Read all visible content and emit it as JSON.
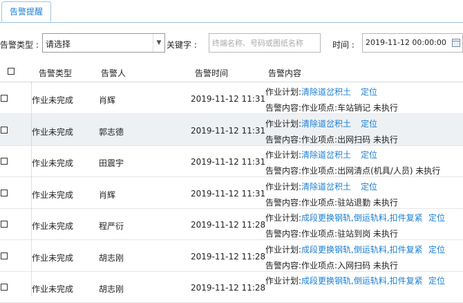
{
  "tab": {
    "label": "告警提醒"
  },
  "filter": {
    "type_label": "告警类型 :",
    "type_value": "请选择",
    "keyword_label": "关键字 :",
    "keyword_placeholder": "终端名称、号码或图纸名称",
    "time_label": "时间 :",
    "time_value": "2019-11-12 00:00:00"
  },
  "table": {
    "headers": {
      "type": "告警类型",
      "person": "告警人",
      "time": "告警时间",
      "content": "告警内容"
    },
    "plan_prefix": "作业计划:",
    "content_prefix": "告警内容:",
    "locate_label": "定位",
    "rows": [
      {
        "type": "作业未完成",
        "person": "肖辉",
        "time": "2019-11-12 11:31",
        "plan": "清除道岔积土",
        "detail": "作业项点:车站销记 未执行"
      },
      {
        "type": "作业未完成",
        "person": "郭志德",
        "time": "2019-11-12 11:31",
        "plan": "清除道岔积土",
        "detail": "作业项点:出网扫码 未执行"
      },
      {
        "type": "作业未完成",
        "person": "田震宇",
        "time": "2019-11-12 11:31",
        "plan": "清除道岔积土",
        "detail": "作业项点:出网清点(机具/人员) 未执行"
      },
      {
        "type": "作业未完成",
        "person": "肖辉",
        "time": "2019-11-12 11:31",
        "plan": "清除道岔积土",
        "detail": "作业项点:驻站退勤 未执行"
      },
      {
        "type": "作业未完成",
        "person": "程严衍",
        "time": "2019-11-12 11:28",
        "plan": "成段更换钢轨,倒运轨料,扣件复紧",
        "detail": "作业项点:驻站到岗 未执行"
      },
      {
        "type": "作业未完成",
        "person": "胡志刚",
        "time": "2019-11-12 11:28",
        "plan": "成段更换钢轨,倒运轨料,扣件复紧",
        "detail": "作业项点:入网扫码 未执行"
      },
      {
        "type": "作业未完成",
        "person": "胡志刚",
        "time": "2019-11-12 11:28",
        "plan": "成段更换钢轨,倒运轨料,扣件复紧",
        "detail": ""
      }
    ]
  }
}
